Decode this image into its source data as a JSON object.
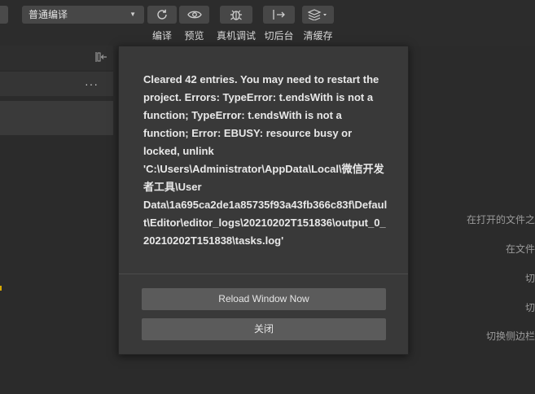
{
  "toolbar": {
    "mode_select": "普通编译",
    "buttons": [
      {
        "label": "编译",
        "icon": "refresh-icon"
      },
      {
        "label": "预览",
        "icon": "eye-icon"
      },
      {
        "label": "真机调试",
        "icon": "bug-icon"
      },
      {
        "label": "切后台",
        "icon": "switch-background-icon"
      },
      {
        "label": "清缓存",
        "icon": "layers-icon"
      }
    ]
  },
  "sidebar": {
    "more": "···"
  },
  "shortcuts": [
    "在打开的文件之",
    "在文件",
    "切",
    "切",
    "切换侧边栏"
  ],
  "dialog": {
    "message": "Cleared 42 entries. You may need to restart the project. Errors: TypeError: t.endsWith is not a function; TypeError: t.endsWith is not a function; Error: EBUSY: resource busy or locked, unlink 'C:\\Users\\Administrator\\AppData\\Local\\微信开发者工具\\User Data\\1a695ca2de1a85735f93a43fb366c83f\\Default\\Editor\\editor_logs\\20210202T151836\\output_0_20210202T151838\\tasks.log'",
    "reload_button": "Reload Window Now",
    "close_button": "关闭"
  },
  "colors": {
    "background": "#2b2b2b",
    "dialog": "#393939",
    "button": "#5b5b5b",
    "marker": "#d8a800"
  }
}
